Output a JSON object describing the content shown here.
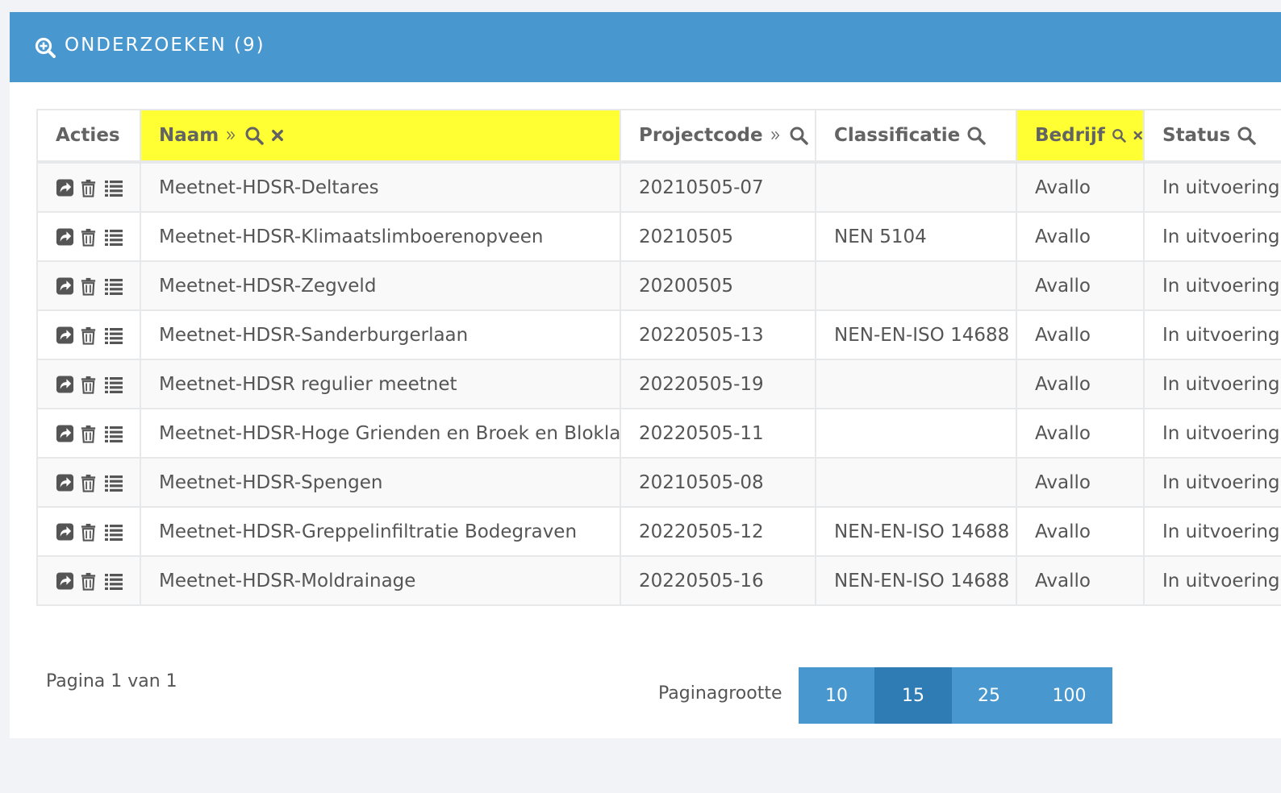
{
  "header": {
    "title": "ONDERZOEKEN (9)",
    "icon": "search-plus-icon"
  },
  "colors": {
    "header_bg": "#4897cf",
    "highlight": "#ffff33",
    "active_page": "#2f7cb4"
  },
  "columns": [
    {
      "key": "acties",
      "label": "Acties",
      "sortable": false,
      "searchable": false,
      "clearable": false,
      "highlighted": false
    },
    {
      "key": "naam",
      "label": "Naam",
      "sortable": true,
      "searchable": true,
      "clearable": true,
      "highlighted": true
    },
    {
      "key": "projectcode",
      "label": "Projectcode",
      "sortable": true,
      "searchable": true,
      "clearable": false,
      "highlighted": false
    },
    {
      "key": "classificatie",
      "label": "Classificatie",
      "sortable": false,
      "searchable": true,
      "clearable": false,
      "highlighted": false
    },
    {
      "key": "bedrijf",
      "label": "Bedrijf",
      "sortable": false,
      "searchable": true,
      "clearable": true,
      "highlighted": true
    },
    {
      "key": "status",
      "label": "Status",
      "sortable": false,
      "searchable": true,
      "clearable": false,
      "highlighted": false
    }
  ],
  "rows": [
    {
      "naam": "Meetnet-HDSR-Deltares",
      "projectcode": "20210505-07",
      "classificatie": "",
      "bedrijf": "Avallo",
      "status": "In uitvoering"
    },
    {
      "naam": "Meetnet-HDSR-Klimaatslimboerenopveen",
      "projectcode": "20210505",
      "classificatie": "NEN 5104",
      "bedrijf": "Avallo",
      "status": "In uitvoering"
    },
    {
      "naam": "Meetnet-HDSR-Zegveld",
      "projectcode": "20200505",
      "classificatie": "",
      "bedrijf": "Avallo",
      "status": "In uitvoering"
    },
    {
      "naam": "Meetnet-HDSR-Sanderburgerlaan",
      "projectcode": "20220505-13",
      "classificatie": "NEN-EN-ISO 14688",
      "bedrijf": "Avallo",
      "status": "In uitvoering"
    },
    {
      "naam": "Meetnet-HDSR regulier meetnet",
      "projectcode": "20220505-19",
      "classificatie": "",
      "bedrijf": "Avallo",
      "status": "In uitvoering"
    },
    {
      "naam": "Meetnet-HDSR-Hoge Grienden en Broek en Blokland",
      "projectcode": "20220505-11",
      "classificatie": "",
      "bedrijf": "Avallo",
      "status": "In uitvoering"
    },
    {
      "naam": "Meetnet-HDSR-Spengen",
      "projectcode": "20210505-08",
      "classificatie": "",
      "bedrijf": "Avallo",
      "status": "In uitvoering"
    },
    {
      "naam": "Meetnet-HDSR-Greppelinfiltratie Bodegraven",
      "projectcode": "20220505-12",
      "classificatie": "NEN-EN-ISO 14688",
      "bedrijf": "Avallo",
      "status": "In uitvoering"
    },
    {
      "naam": "Meetnet-HDSR-Moldrainage",
      "projectcode": "20220505-16",
      "classificatie": "NEN-EN-ISO 14688",
      "bedrijf": "Avallo",
      "status": "In uitvoering"
    }
  ],
  "row_action_icons": [
    "share-icon",
    "trash-icon",
    "list-icon"
  ],
  "pagination": {
    "text": "Pagina 1 van 1"
  },
  "page_size": {
    "label": "Paginagrootte",
    "options": [
      "10",
      "15",
      "25",
      "100"
    ],
    "selected": "15"
  }
}
